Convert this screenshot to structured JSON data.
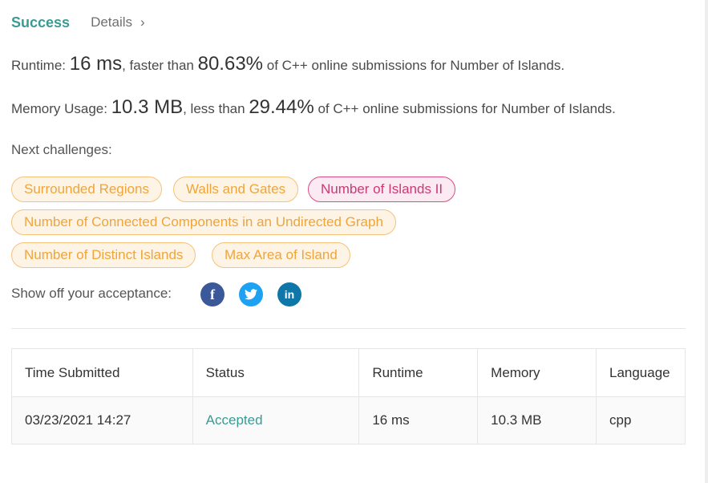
{
  "header": {
    "status": "Success",
    "details_label": "Details",
    "chevron": "›"
  },
  "runtime": {
    "label": "Runtime: ",
    "value": "16 ms",
    "mid": ", faster than ",
    "percent": "80.63%",
    "tail": " of C++ online submissions for Number of Islands."
  },
  "memory": {
    "label": "Memory Usage: ",
    "value": "10.3 MB",
    "mid": ", less than ",
    "percent": "29.44%",
    "tail": " of C++ online submissions for Number of Islands."
  },
  "next_challenges": {
    "label": "Next challenges:",
    "items": [
      {
        "label": "Surrounded Regions",
        "difficulty": "medium"
      },
      {
        "label": "Walls and Gates",
        "difficulty": "medium"
      },
      {
        "label": "Number of Islands II",
        "difficulty": "hard"
      },
      {
        "label": "Number of Connected Components in an Undirected Graph",
        "difficulty": "medium"
      },
      {
        "label": "Number of Distinct Islands",
        "difficulty": "medium"
      },
      {
        "label": "Max Area of Island",
        "difficulty": "medium"
      }
    ]
  },
  "share": {
    "label": "Show off your acceptance:",
    "icons": [
      "facebook-icon",
      "twitter-icon",
      "linkedin-icon"
    ]
  },
  "table": {
    "headers": [
      "Time Submitted",
      "Status",
      "Runtime",
      "Memory",
      "Language"
    ],
    "rows": [
      {
        "time": "03/23/2021 14:27",
        "status": "Accepted",
        "runtime": "16 ms",
        "memory": "10.3 MB",
        "language": "cpp"
      }
    ]
  },
  "colors": {
    "success": "#3a9b94",
    "medium_tag": "#f0a43a",
    "hard_tag": "#c83a76",
    "facebook": "#3b5998",
    "twitter": "#1da1f2",
    "linkedin": "#0e76a8"
  }
}
